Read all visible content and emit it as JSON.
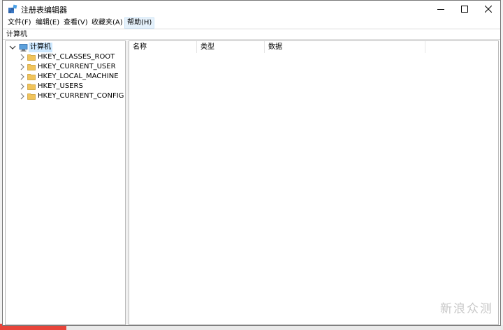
{
  "window": {
    "title": "注册表编辑器",
    "minimize_icon": "minimize-icon",
    "maximize_icon": "maximize-icon",
    "close_icon": "close-icon"
  },
  "menu": {
    "items": [
      "文件(F)",
      "编辑(E)",
      "查看(V)",
      "收藏夹(A)",
      "帮助(H)"
    ],
    "active_index": 4
  },
  "address": {
    "path": "计算机"
  },
  "tree": {
    "root": {
      "label": "计算机",
      "icon": "computer-icon",
      "expanded": true
    },
    "children": [
      {
        "label": "HKEY_CLASSES_ROOT",
        "icon": "folder-icon"
      },
      {
        "label": "HKEY_CURRENT_USER",
        "icon": "folder-icon"
      },
      {
        "label": "HKEY_LOCAL_MACHINE",
        "icon": "folder-icon"
      },
      {
        "label": "HKEY_USERS",
        "icon": "folder-icon"
      },
      {
        "label": "HKEY_CURRENT_CONFIG",
        "icon": "folder-icon"
      }
    ]
  },
  "list": {
    "columns": [
      "名称",
      "类型",
      "数据"
    ]
  },
  "watermark": "新浪众测",
  "colors": {
    "selection": "#cce8ff",
    "folder": "#e8b84a",
    "menu_hover": "#e5f1fb"
  }
}
